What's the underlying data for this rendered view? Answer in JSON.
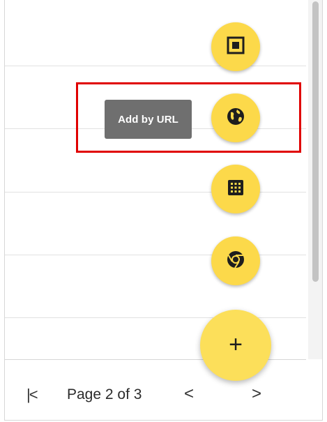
{
  "tooltip": {
    "label": "Add by URL"
  },
  "fab_actions": [
    {
      "name": "square-icon",
      "title": ""
    },
    {
      "name": "globe-icon",
      "title": "Add by URL"
    },
    {
      "name": "grid-icon",
      "title": ""
    },
    {
      "name": "chrome-icon",
      "title": ""
    }
  ],
  "fab_main": {
    "label": "+"
  },
  "pager": {
    "first_label": "|<",
    "page_label": "Page 2 of 3",
    "prev_label": "<",
    "next_label": ">"
  },
  "colors": {
    "fab": "#fcd94a",
    "tooltip_bg": "#6f6f6f",
    "highlight": "#e00000"
  }
}
